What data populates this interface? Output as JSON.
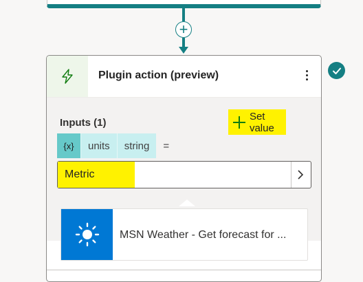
{
  "canvas": {
    "add_step_symbol": "+"
  },
  "action_card": {
    "icon": "plugin-bolt-icon",
    "title": "Plugin action (preview)",
    "menu_icon": "more-vertical-icon",
    "status_icon": "check-circle-icon",
    "inputs": {
      "label": "Inputs (1)",
      "set_value_label": "Set value",
      "variable_symbol": "{x}",
      "variable_name": "units",
      "variable_type": "string",
      "assign_symbol": "=",
      "value": "Metric"
    },
    "connector": {
      "icon": "weather-sun-icon",
      "label": "MSN Weather - Get forecast for ..."
    }
  },
  "colors": {
    "accent": "#157f83",
    "highlight": "#fff200",
    "weather_tile": "#0078d4"
  }
}
